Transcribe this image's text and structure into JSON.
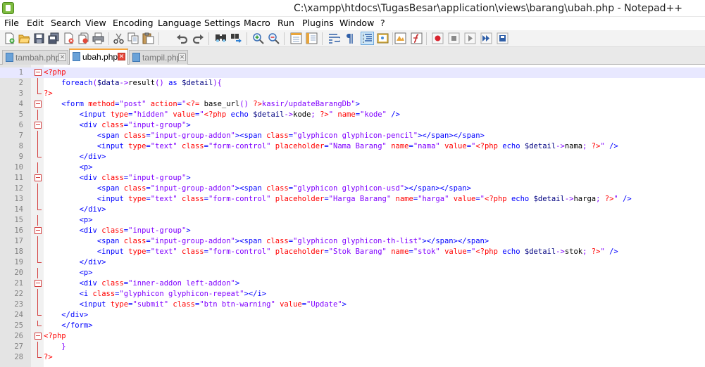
{
  "window": {
    "title": "C:\\xampp\\htdocs\\TugasBesar\\application\\views\\barang\\ubah.php - Notepad++"
  },
  "menu": [
    "File",
    "Edit",
    "Search",
    "View",
    "Encoding",
    "Language",
    "Settings",
    "Macro",
    "Run",
    "Plugins",
    "Window",
    "?"
  ],
  "toolbar": [
    "new-icon",
    "open-icon",
    "save-icon",
    "save-all-icon",
    "close-icon",
    "close-all-icon",
    "print-icon",
    "cut-icon",
    "copy-icon",
    "paste-icon",
    "undo-icon",
    "redo-icon",
    "find-icon",
    "replace-icon",
    "zoom-in-icon",
    "zoom-out-icon",
    "sync-vertical-icon",
    "sync-horizontal-icon",
    "word-wrap-icon",
    "show-all-characters-icon",
    "indent-guide-icon",
    "document-map-icon",
    "folder-workspace-icon",
    "function-list-icon",
    "record-macro-icon",
    "stop-recording-icon",
    "play-macro-icon",
    "run-macro-multiple-icon",
    "save-macro-icon"
  ],
  "tabs": [
    {
      "label": "tambah.php",
      "active": false
    },
    {
      "label": "ubah.php",
      "active": true
    },
    {
      "label": "tampil.php",
      "active": false
    }
  ],
  "colors": {
    "php": "#ff0000",
    "tag": "#0000ff",
    "attr": "#ff0000",
    "value": "#8000ff",
    "keyword": "#0000ff",
    "variable": "#000080",
    "operator": "#8000ff",
    "fold": "#d43d3d",
    "current_line": "#e8e8ff"
  },
  "current_line": 1,
  "lines": [
    {
      "n": "1",
      "fold": "box",
      "segs": [
        [
          "php",
          "<?php"
        ]
      ]
    },
    {
      "n": "2",
      "fold": "line",
      "segs": [
        [
          "txt",
          "    "
        ],
        [
          "kw",
          "foreach"
        ],
        [
          "op",
          "("
        ],
        [
          "var",
          "$data"
        ],
        [
          "op",
          "->"
        ],
        [
          "txt",
          "result"
        ],
        [
          "op",
          "()"
        ],
        [
          "txt",
          " "
        ],
        [
          "kw",
          "as"
        ],
        [
          "txt",
          " "
        ],
        [
          "var",
          "$detail"
        ],
        [
          "op",
          "){"
        ]
      ]
    },
    {
      "n": "3",
      "fold": "end",
      "segs": [
        [
          "php",
          "?>"
        ]
      ]
    },
    {
      "n": "4",
      "fold": "box",
      "segs": [
        [
          "txt",
          "    "
        ],
        [
          "tag",
          "<form "
        ],
        [
          "attr",
          "method"
        ],
        [
          "tag",
          "="
        ],
        [
          "val",
          "\"post\""
        ],
        [
          "txt",
          " "
        ],
        [
          "attr",
          "action"
        ],
        [
          "tag",
          "="
        ],
        [
          "val",
          "\""
        ],
        [
          "php",
          "<?="
        ],
        [
          "txt",
          " base_url"
        ],
        [
          "op",
          "()"
        ],
        [
          "txt",
          " "
        ],
        [
          "php",
          "?>"
        ],
        [
          "val",
          "kasir/updateBarangDb\""
        ],
        [
          "tag",
          ">"
        ]
      ]
    },
    {
      "n": "5",
      "fold": "line",
      "segs": [
        [
          "txt",
          "        "
        ],
        [
          "tag",
          "<input "
        ],
        [
          "attr",
          "type"
        ],
        [
          "tag",
          "="
        ],
        [
          "val",
          "\"hidden\""
        ],
        [
          "txt",
          " "
        ],
        [
          "attr",
          "value"
        ],
        [
          "tag",
          "="
        ],
        [
          "val",
          "\""
        ],
        [
          "php",
          "<?php"
        ],
        [
          "txt",
          " "
        ],
        [
          "kw",
          "echo"
        ],
        [
          "txt",
          " "
        ],
        [
          "var",
          "$detail"
        ],
        [
          "op",
          "->"
        ],
        [
          "txt",
          "kode"
        ],
        [
          "op",
          ";"
        ],
        [
          "txt",
          " "
        ],
        [
          "php",
          "?>"
        ],
        [
          "val",
          "\""
        ],
        [
          "txt",
          " "
        ],
        [
          "attr",
          "name"
        ],
        [
          "tag",
          "="
        ],
        [
          "val",
          "\"kode\""
        ],
        [
          "txt",
          " "
        ],
        [
          "tag",
          "/>"
        ]
      ]
    },
    {
      "n": "6",
      "fold": "box",
      "segs": [
        [
          "txt",
          "        "
        ],
        [
          "tag",
          "<div "
        ],
        [
          "attr",
          "class"
        ],
        [
          "tag",
          "="
        ],
        [
          "val",
          "\"input-group\""
        ],
        [
          "tag",
          ">"
        ]
      ]
    },
    {
      "n": "7",
      "fold": "line",
      "segs": [
        [
          "txt",
          "            "
        ],
        [
          "tag",
          "<span "
        ],
        [
          "attr",
          "class"
        ],
        [
          "tag",
          "="
        ],
        [
          "val",
          "\"input-group-addon\""
        ],
        [
          "tag",
          "><span "
        ],
        [
          "attr",
          "class"
        ],
        [
          "tag",
          "="
        ],
        [
          "val",
          "\"glyphicon glyphicon-pencil\""
        ],
        [
          "tag",
          "></span></span>"
        ]
      ]
    },
    {
      "n": "8",
      "fold": "line",
      "segs": [
        [
          "txt",
          "            "
        ],
        [
          "tag",
          "<input "
        ],
        [
          "attr",
          "type"
        ],
        [
          "tag",
          "="
        ],
        [
          "val",
          "\"text\""
        ],
        [
          "txt",
          " "
        ],
        [
          "attr",
          "class"
        ],
        [
          "tag",
          "="
        ],
        [
          "val",
          "\"form-control\""
        ],
        [
          "txt",
          " "
        ],
        [
          "attr",
          "placeholder"
        ],
        [
          "tag",
          "="
        ],
        [
          "val",
          "\"Nama Barang\""
        ],
        [
          "txt",
          " "
        ],
        [
          "attr",
          "name"
        ],
        [
          "tag",
          "="
        ],
        [
          "val",
          "\"nama\""
        ],
        [
          "txt",
          " "
        ],
        [
          "attr",
          "value"
        ],
        [
          "tag",
          "="
        ],
        [
          "val",
          "\""
        ],
        [
          "php",
          "<?php"
        ],
        [
          "txt",
          " "
        ],
        [
          "kw",
          "echo"
        ],
        [
          "txt",
          " "
        ],
        [
          "var",
          "$detail"
        ],
        [
          "op",
          "->"
        ],
        [
          "txt",
          "nama"
        ],
        [
          "op",
          ";"
        ],
        [
          "txt",
          " "
        ],
        [
          "php",
          "?>"
        ],
        [
          "val",
          "\""
        ],
        [
          "txt",
          " "
        ],
        [
          "tag",
          "/>"
        ]
      ]
    },
    {
      "n": "9",
      "fold": "end",
      "segs": [
        [
          "txt",
          "        "
        ],
        [
          "tag",
          "</div>"
        ]
      ]
    },
    {
      "n": "10",
      "fold": "line",
      "segs": [
        [
          "txt",
          "        "
        ],
        [
          "tag",
          "<p>"
        ]
      ]
    },
    {
      "n": "11",
      "fold": "box",
      "segs": [
        [
          "txt",
          "        "
        ],
        [
          "tag",
          "<div "
        ],
        [
          "attr",
          "class"
        ],
        [
          "tag",
          "="
        ],
        [
          "val",
          "\"input-group\""
        ],
        [
          "tag",
          ">"
        ]
      ]
    },
    {
      "n": "12",
      "fold": "line",
      "segs": [
        [
          "txt",
          "            "
        ],
        [
          "tag",
          "<span "
        ],
        [
          "attr",
          "class"
        ],
        [
          "tag",
          "="
        ],
        [
          "val",
          "\"input-group-addon\""
        ],
        [
          "tag",
          "><span "
        ],
        [
          "attr",
          "class"
        ],
        [
          "tag",
          "="
        ],
        [
          "val",
          "\"glyphicon glyphicon-usd\""
        ],
        [
          "tag",
          "></span></span>"
        ]
      ]
    },
    {
      "n": "13",
      "fold": "line",
      "segs": [
        [
          "txt",
          "            "
        ],
        [
          "tag",
          "<input "
        ],
        [
          "attr",
          "type"
        ],
        [
          "tag",
          "="
        ],
        [
          "val",
          "\"text\""
        ],
        [
          "txt",
          " "
        ],
        [
          "attr",
          "class"
        ],
        [
          "tag",
          "="
        ],
        [
          "val",
          "\"form-control\""
        ],
        [
          "txt",
          " "
        ],
        [
          "attr",
          "placeholder"
        ],
        [
          "tag",
          "="
        ],
        [
          "val",
          "\"Harga Barang\""
        ],
        [
          "txt",
          " "
        ],
        [
          "attr",
          "name"
        ],
        [
          "tag",
          "="
        ],
        [
          "val",
          "\"harga\""
        ],
        [
          "txt",
          " "
        ],
        [
          "attr",
          "value"
        ],
        [
          "tag",
          "="
        ],
        [
          "val",
          "\""
        ],
        [
          "php",
          "<?php"
        ],
        [
          "txt",
          " "
        ],
        [
          "kw",
          "echo"
        ],
        [
          "txt",
          " "
        ],
        [
          "var",
          "$detail"
        ],
        [
          "op",
          "->"
        ],
        [
          "txt",
          "harga"
        ],
        [
          "op",
          ";"
        ],
        [
          "txt",
          " "
        ],
        [
          "php",
          "?>"
        ],
        [
          "val",
          "\""
        ],
        [
          "txt",
          " "
        ],
        [
          "tag",
          "/>"
        ]
      ]
    },
    {
      "n": "14",
      "fold": "end",
      "segs": [
        [
          "txt",
          "        "
        ],
        [
          "tag",
          "</div>"
        ]
      ]
    },
    {
      "n": "15",
      "fold": "line",
      "segs": [
        [
          "txt",
          "        "
        ],
        [
          "tag",
          "<p>"
        ]
      ]
    },
    {
      "n": "16",
      "fold": "box",
      "segs": [
        [
          "txt",
          "        "
        ],
        [
          "tag",
          "<div "
        ],
        [
          "attr",
          "class"
        ],
        [
          "tag",
          "="
        ],
        [
          "val",
          "\"input-group\""
        ],
        [
          "tag",
          ">"
        ]
      ]
    },
    {
      "n": "17",
      "fold": "line",
      "segs": [
        [
          "txt",
          "            "
        ],
        [
          "tag",
          "<span "
        ],
        [
          "attr",
          "class"
        ],
        [
          "tag",
          "="
        ],
        [
          "val",
          "\"input-group-addon\""
        ],
        [
          "tag",
          "><span "
        ],
        [
          "attr",
          "class"
        ],
        [
          "tag",
          "="
        ],
        [
          "val",
          "\"glyphicon glyphicon-th-list\""
        ],
        [
          "tag",
          "></span></span>"
        ]
      ]
    },
    {
      "n": "18",
      "fold": "line",
      "segs": [
        [
          "txt",
          "            "
        ],
        [
          "tag",
          "<input "
        ],
        [
          "attr",
          "type"
        ],
        [
          "tag",
          "="
        ],
        [
          "val",
          "\"text\""
        ],
        [
          "txt",
          " "
        ],
        [
          "attr",
          "class"
        ],
        [
          "tag",
          "="
        ],
        [
          "val",
          "\"form-control\""
        ],
        [
          "txt",
          " "
        ],
        [
          "attr",
          "placeholder"
        ],
        [
          "tag",
          "="
        ],
        [
          "val",
          "\"Stok Barang\""
        ],
        [
          "txt",
          " "
        ],
        [
          "attr",
          "name"
        ],
        [
          "tag",
          "="
        ],
        [
          "val",
          "\"stok\""
        ],
        [
          "txt",
          " "
        ],
        [
          "attr",
          "value"
        ],
        [
          "tag",
          "="
        ],
        [
          "val",
          "\""
        ],
        [
          "php",
          "<?php"
        ],
        [
          "txt",
          " "
        ],
        [
          "kw",
          "echo"
        ],
        [
          "txt",
          " "
        ],
        [
          "var",
          "$detail"
        ],
        [
          "op",
          "->"
        ],
        [
          "txt",
          "stok"
        ],
        [
          "op",
          ";"
        ],
        [
          "txt",
          " "
        ],
        [
          "php",
          "?>"
        ],
        [
          "val",
          "\""
        ],
        [
          "txt",
          " "
        ],
        [
          "tag",
          "/>"
        ]
      ]
    },
    {
      "n": "19",
      "fold": "end",
      "segs": [
        [
          "txt",
          "        "
        ],
        [
          "tag",
          "</div>"
        ]
      ]
    },
    {
      "n": "20",
      "fold": "line",
      "segs": [
        [
          "txt",
          "        "
        ],
        [
          "tag",
          "<p>"
        ]
      ]
    },
    {
      "n": "21",
      "fold": "box",
      "segs": [
        [
          "txt",
          "        "
        ],
        [
          "tag",
          "<div "
        ],
        [
          "attr",
          "class"
        ],
        [
          "tag",
          "="
        ],
        [
          "val",
          "\"inner-addon left-addon\""
        ],
        [
          "tag",
          ">"
        ]
      ]
    },
    {
      "n": "22",
      "fold": "line",
      "segs": [
        [
          "txt",
          "        "
        ],
        [
          "tag",
          "<i "
        ],
        [
          "attr",
          "class"
        ],
        [
          "tag",
          "="
        ],
        [
          "val",
          "\"glyphicon glyphicon-repeat\""
        ],
        [
          "tag",
          "></i>"
        ]
      ]
    },
    {
      "n": "23",
      "fold": "line",
      "segs": [
        [
          "txt",
          "        "
        ],
        [
          "tag",
          "<input "
        ],
        [
          "attr",
          "type"
        ],
        [
          "tag",
          "="
        ],
        [
          "val",
          "\"submit\""
        ],
        [
          "txt",
          " "
        ],
        [
          "attr",
          "class"
        ],
        [
          "tag",
          "="
        ],
        [
          "val",
          "\"btn btn-warning\""
        ],
        [
          "txt",
          " "
        ],
        [
          "attr",
          "value"
        ],
        [
          "tag",
          "="
        ],
        [
          "val",
          "\"Update\""
        ],
        [
          "tag",
          ">"
        ]
      ]
    },
    {
      "n": "24",
      "fold": "end",
      "segs": [
        [
          "txt",
          "    "
        ],
        [
          "tag",
          "</div>"
        ]
      ]
    },
    {
      "n": "25",
      "fold": "end",
      "segs": [
        [
          "txt",
          "    "
        ],
        [
          "tag",
          "</form>"
        ]
      ]
    },
    {
      "n": "26",
      "fold": "box",
      "segs": [
        [
          "php",
          "<?php"
        ]
      ]
    },
    {
      "n": "27",
      "fold": "line",
      "segs": [
        [
          "txt",
          "    "
        ],
        [
          "op",
          "}"
        ]
      ]
    },
    {
      "n": "28",
      "fold": "end",
      "segs": [
        [
          "php",
          "?>"
        ]
      ]
    }
  ]
}
